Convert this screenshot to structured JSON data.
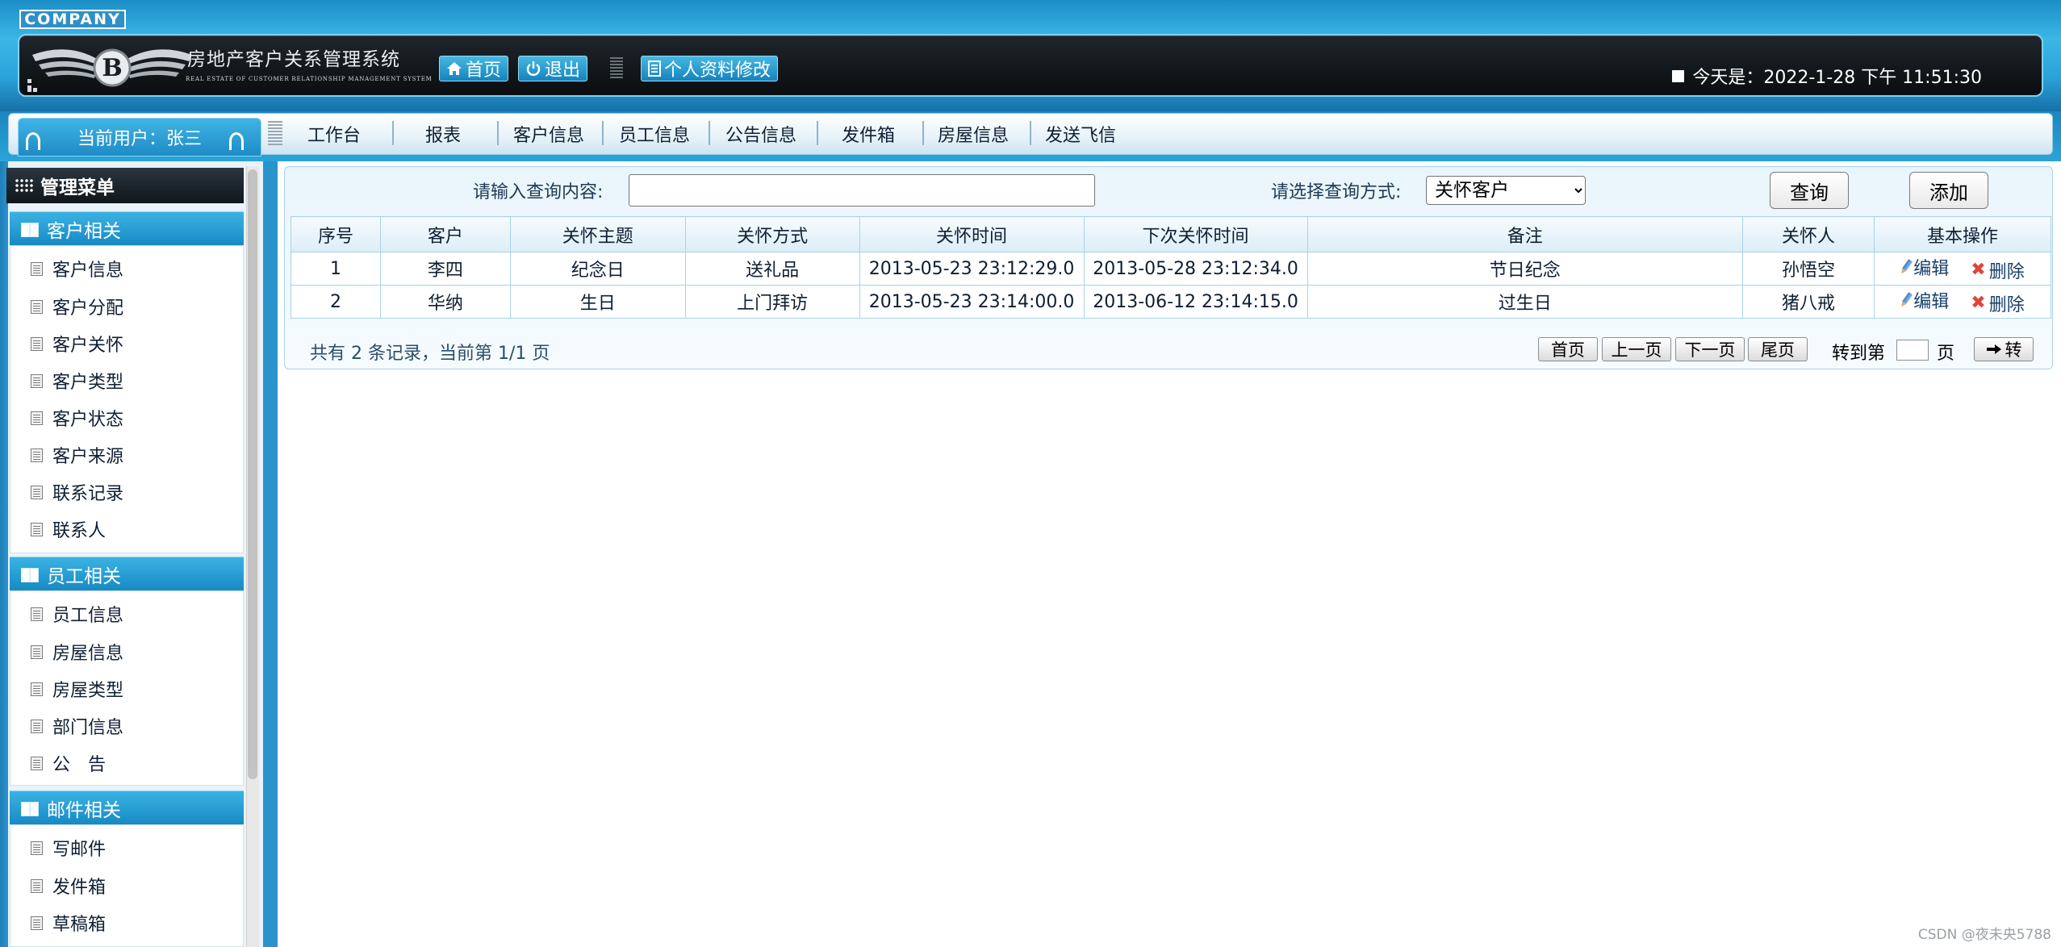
{
  "header": {
    "company": "COMPANY",
    "system_title": "房地产客户关系管理系统",
    "system_subtitle": "REAL ESTATE OF CUSTOMER RELATIONSHIP MANAGEMENT SYSTEM",
    "home_label": "首页",
    "logout_label": "退出",
    "profile_label": "个人资料修改",
    "date_text": "今天是：2022-1-28 下午 11:51:30"
  },
  "nav": {
    "current_user": "当前用户：张三",
    "items": [
      "工作台",
      "报表",
      "客户信息",
      "员工信息",
      "公告信息",
      "发件箱",
      "房屋信息",
      "发送飞信"
    ]
  },
  "sidebar": {
    "title": "管理菜单",
    "groups": [
      {
        "title": "客户相关",
        "items": [
          "客户信息",
          "客户分配",
          "客户关怀",
          "客户类型",
          "客户状态",
          "客户来源",
          "联系记录",
          "联系人"
        ]
      },
      {
        "title": "员工相关",
        "items": [
          "员工信息",
          "房屋信息",
          "房屋类型",
          "部门信息",
          "公　告"
        ]
      },
      {
        "title": "邮件相关",
        "items": [
          "写邮件",
          "发件箱",
          "草稿箱"
        ]
      }
    ]
  },
  "search": {
    "content_label": "请输入查询内容:",
    "content_value": "",
    "mode_label": "请选择查询方式:",
    "mode_value": "关怀客户",
    "query_button": "查询",
    "add_button": "添加"
  },
  "table": {
    "columns": [
      "序号",
      "客户",
      "关怀主题",
      "关怀方式",
      "关怀时间",
      "下次关怀时间",
      "备注",
      "关怀人",
      "基本操作"
    ],
    "rows": [
      {
        "no": "1",
        "customer": "李四",
        "topic": "纪念日",
        "method": "送礼品",
        "time": "2013-05-23 23:12:29.0",
        "next_time": "2013-05-28 23:12:34.0",
        "remark": "节日纪念",
        "person": "孙悟空",
        "edit": "编辑",
        "delete": "删除"
      },
      {
        "no": "2",
        "customer": "华纳",
        "topic": "生日",
        "method": "上门拜访",
        "time": "2013-05-23 23:14:00.0",
        "next_time": "2013-06-12 23:14:15.0",
        "remark": "过生日",
        "person": "猪八戒",
        "edit": "编辑",
        "delete": "删除"
      }
    ]
  },
  "pagination": {
    "summary": "共有 2 条记录，当前第 1/1 页",
    "first": "首页",
    "prev": "上一页",
    "next": "下一页",
    "last": "尾页",
    "goto_prefix": "转到第",
    "goto_suffix": "页",
    "goto_button": "转"
  },
  "watermark": "CSDN @夜未央5788",
  "icons": {
    "home": "home-icon",
    "logout": "power-icon",
    "profile": "profile-icon",
    "edit": "pencil-icon",
    "delete": "x-icon",
    "goto": "arrow-right-icon"
  }
}
